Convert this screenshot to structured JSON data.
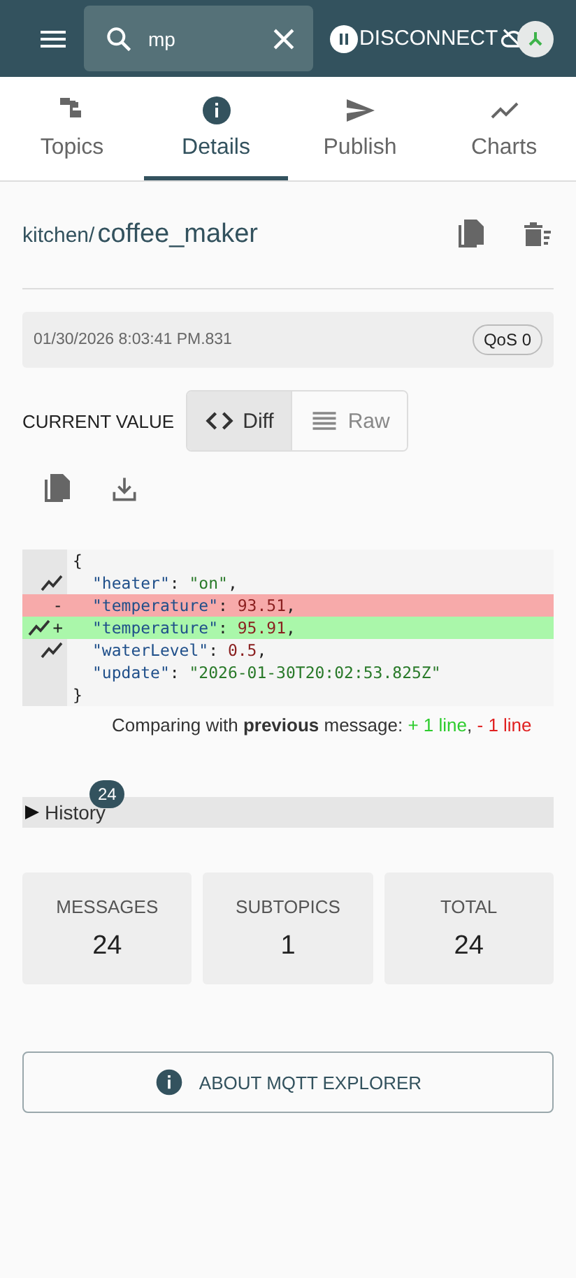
{
  "app_bar": {
    "search": {
      "value": "mp"
    },
    "connection_button": "DISCONNECT"
  },
  "tabs": [
    {
      "label": "Topics",
      "selected": false
    },
    {
      "label": "Details",
      "selected": true
    },
    {
      "label": "Publish",
      "selected": false
    },
    {
      "label": "Charts",
      "selected": false
    }
  ],
  "topic": {
    "path": [
      {
        "text": "kitchen/",
        "kind": "parent"
      },
      {
        "text": "coffee_maker",
        "kind": "leaf"
      }
    ]
  },
  "message": {
    "timestamp": "01/30/2026 8:03:41 PM.831",
    "qos": "QoS 0"
  },
  "current_value": {
    "label": "CURRENT VALUE",
    "modes": [
      {
        "label": "Diff",
        "selected": true
      },
      {
        "label": "Raw",
        "selected": false
      }
    ]
  },
  "diff": {
    "lines": [
      {
        "kind": "context",
        "chart": false,
        "indented": false,
        "tokens": [
          {
            "kind": "punct",
            "text": "{"
          }
        ]
      },
      {
        "kind": "context",
        "chart": true,
        "indented": true,
        "tokens": [
          {
            "kind": "key",
            "text": "\"heater\""
          },
          {
            "kind": "punct",
            "text": ": "
          },
          {
            "kind": "string",
            "text": "\"on\""
          },
          {
            "kind": "punct",
            "text": ","
          }
        ]
      },
      {
        "kind": "removed",
        "chart": false,
        "sign": "-",
        "indented": true,
        "tokens": [
          {
            "kind": "key",
            "text": "\"temperature\""
          },
          {
            "kind": "punct",
            "text": ": "
          },
          {
            "kind": "number",
            "text": "93.51"
          },
          {
            "kind": "punct",
            "text": ","
          }
        ]
      },
      {
        "kind": "added",
        "chart": true,
        "sign": "+",
        "indented": true,
        "tokens": [
          {
            "kind": "key",
            "text": "\"temperature\""
          },
          {
            "kind": "punct",
            "text": ": "
          },
          {
            "kind": "number",
            "text": "95.91"
          },
          {
            "kind": "punct",
            "text": ","
          }
        ]
      },
      {
        "kind": "context",
        "chart": true,
        "indented": true,
        "tokens": [
          {
            "kind": "key",
            "text": "\"waterLevel\""
          },
          {
            "kind": "punct",
            "text": ": "
          },
          {
            "kind": "number",
            "text": "0.5"
          },
          {
            "kind": "punct",
            "text": ","
          }
        ]
      },
      {
        "kind": "context",
        "chart": false,
        "indented": true,
        "tokens": [
          {
            "kind": "key",
            "text": "\"update\""
          },
          {
            "kind": "punct",
            "text": ": "
          },
          {
            "kind": "string",
            "text": "\"2026-01-30T20:02:53.825Z\""
          }
        ]
      },
      {
        "kind": "context",
        "chart": false,
        "indented": false,
        "tokens": [
          {
            "kind": "punct",
            "text": "}"
          }
        ]
      }
    ],
    "summary": {
      "text": "Comparing with **previous** message: ",
      "added": "+ 1 line",
      "separator": ", ",
      "removed": "- 1 line"
    }
  },
  "history": {
    "label": "History",
    "count": "24",
    "expanded": false
  },
  "stats": [
    {
      "label": "MESSAGES",
      "value": "24"
    },
    {
      "label": "SUBTOPICS",
      "value": "1"
    },
    {
      "label": "TOTAL",
      "value": "24"
    }
  ],
  "about_button": "ABOUT MQTT EXPLORER"
}
